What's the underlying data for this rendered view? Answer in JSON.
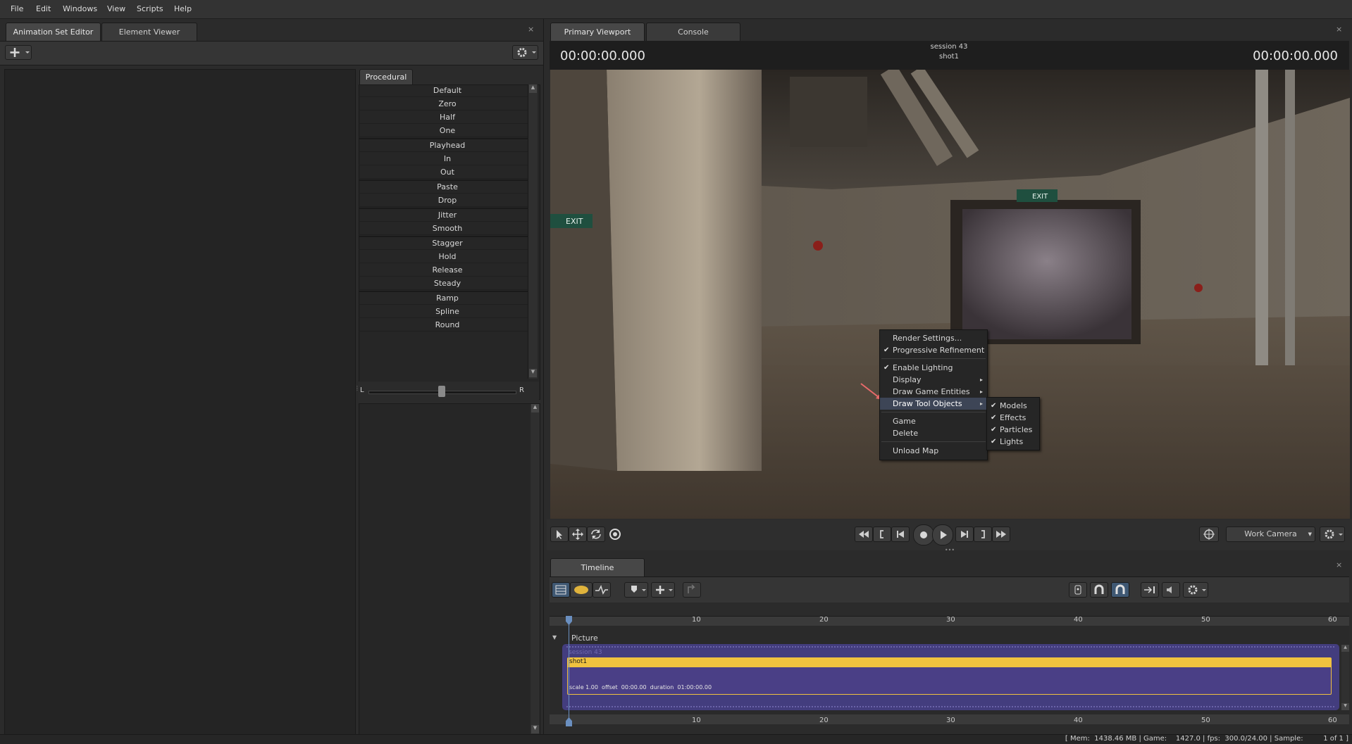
{
  "menubar": {
    "items": [
      "File",
      "Edit",
      "Windows",
      "View",
      "Scripts",
      "Help"
    ]
  },
  "left_panel": {
    "tabs": [
      "Animation Set Editor",
      "Element Viewer"
    ],
    "close": "×",
    "procedural_tab": "Procedural",
    "procedural_items": [
      "Default",
      "Zero",
      "Half",
      "One",
      "Playhead",
      "In",
      "Out",
      "Paste",
      "Drop",
      "Jitter",
      "Smooth",
      "Stagger",
      "Hold",
      "Release",
      "Steady",
      "Ramp",
      "Spline",
      "Round"
    ],
    "balance_left": "L",
    "balance_right": "R",
    "balance_value": 0.5
  },
  "viewport_panel": {
    "tabs": [
      "Primary Viewport",
      "Console"
    ],
    "close": "×",
    "time_left": "00:00:00.000",
    "time_right": "00:00:00.000",
    "session_name": "session 43",
    "shot_name": "shot1",
    "scene": {
      "exit_sign_left": "EXIT",
      "exit_sign_center": "EXIT"
    },
    "camera": "Work Camera"
  },
  "context_menu": {
    "items": [
      {
        "label": "Render Settings...",
        "checked": false,
        "submenu": false
      },
      {
        "label": "Progressive Refinement",
        "checked": true,
        "submenu": false
      },
      {
        "label": "Enable Lighting",
        "checked": true,
        "submenu": false
      },
      {
        "label": "Display",
        "checked": false,
        "submenu": true
      },
      {
        "label": "Draw Game Entities",
        "checked": false,
        "submenu": true
      },
      {
        "label": "Draw Tool Objects",
        "checked": false,
        "submenu": true,
        "highlighted": true
      },
      {
        "label": "Game",
        "checked": false,
        "submenu": true
      },
      {
        "label": "Delete",
        "checked": false,
        "submenu": true
      },
      {
        "label": "Unload Map",
        "checked": false,
        "submenu": false
      }
    ],
    "submenu": [
      {
        "label": "Models",
        "checked": true
      },
      {
        "label": "Effects",
        "checked": true
      },
      {
        "label": "Particles",
        "checked": true
      },
      {
        "label": "Lights",
        "checked": true
      }
    ],
    "check_glyph": "✔",
    "arrow_glyph": "▸"
  },
  "timeline": {
    "tab": "Timeline",
    "close": "×",
    "ticks": [
      "10",
      "20",
      "30",
      "40",
      "50",
      "60"
    ],
    "track_name": "Picture",
    "clip_session": "session 43",
    "clip_shot": "shot1",
    "clip_info": "scale 1.00  offset  00:00.00  duration  01:00:00.00"
  },
  "statusbar": {
    "text": "[ Mem:  1438.46 MB | Game:    1427.0 | fps:  300.0/24.00 | Sample:         1 of 1 ]"
  },
  "colors": {
    "accent_clip": "#f0c23f",
    "clip_bg": "#433d7e",
    "playhead": "#6a8fc0",
    "arrow_annotation": "#e86a6a"
  }
}
